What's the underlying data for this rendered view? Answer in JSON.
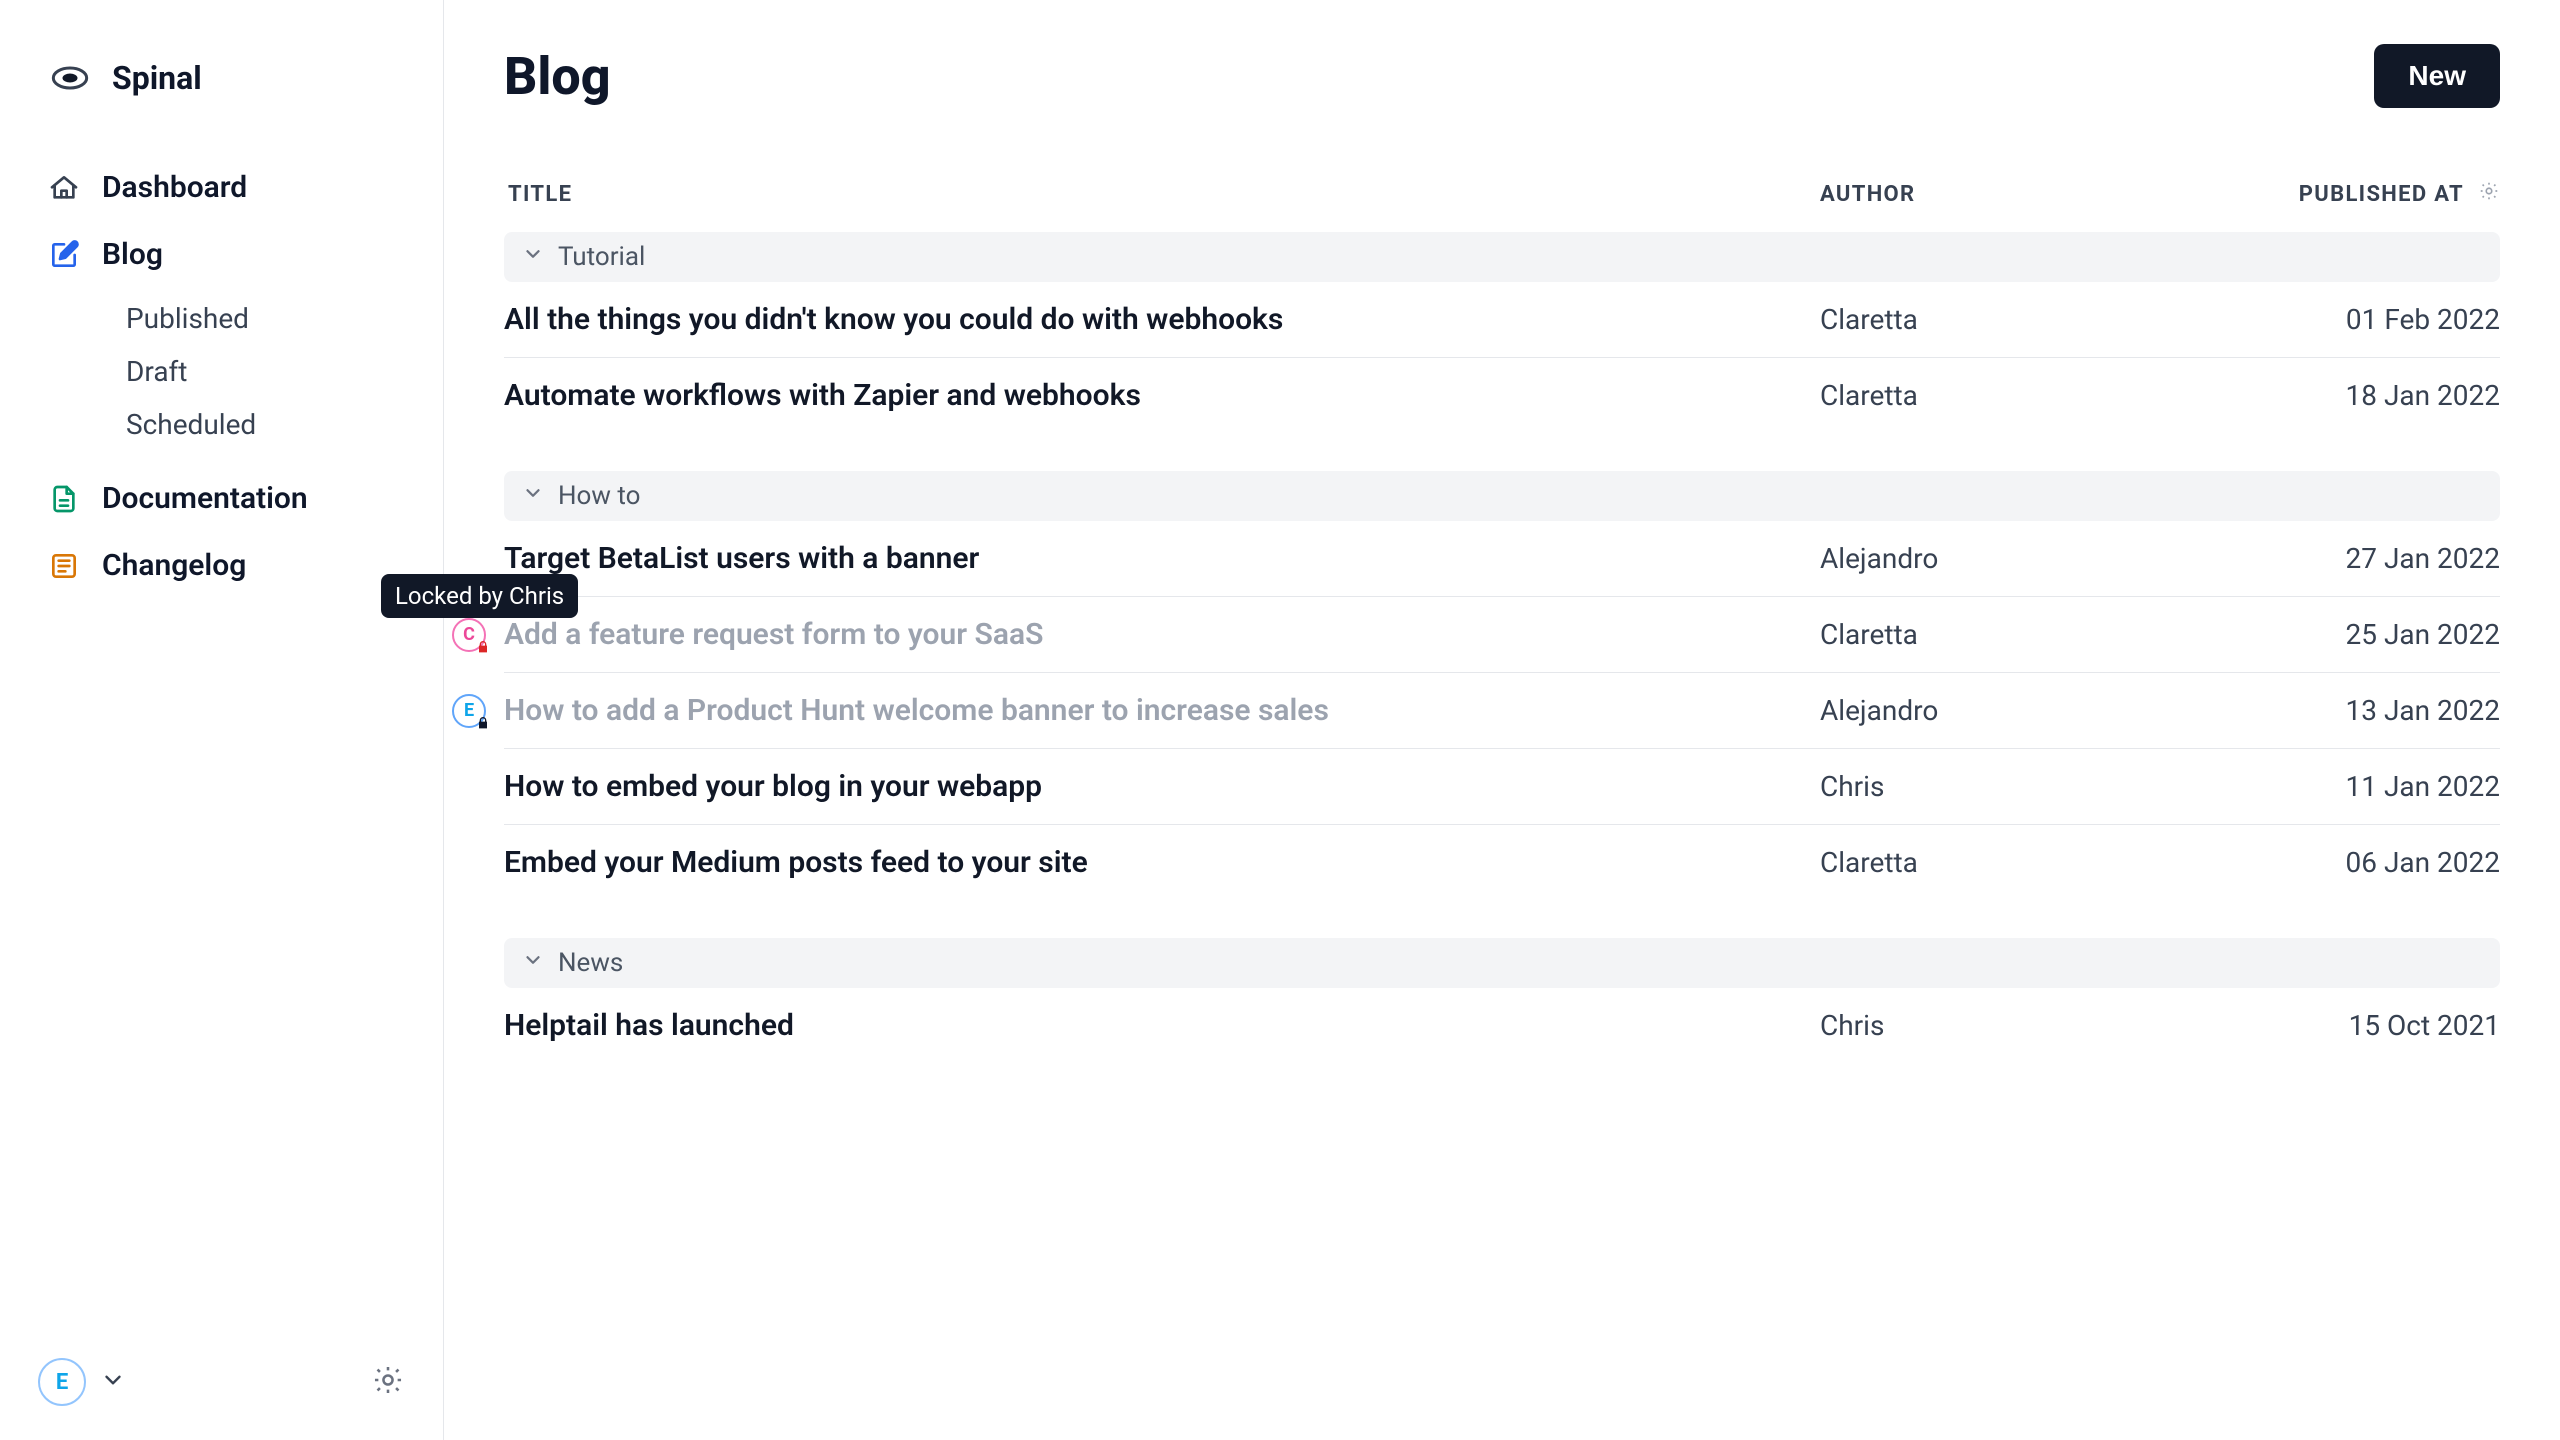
{
  "brand": {
    "name": "Spinal"
  },
  "sidebar": {
    "items": [
      {
        "label": "Dashboard"
      },
      {
        "label": "Blog"
      },
      {
        "label": "Documentation"
      },
      {
        "label": "Changelog"
      }
    ],
    "blog_sub": [
      {
        "label": "Published"
      },
      {
        "label": "Draft"
      },
      {
        "label": "Scheduled"
      }
    ],
    "user_initial": "E"
  },
  "page": {
    "title": "Blog",
    "new_button": "New"
  },
  "columns": {
    "title": "TITLE",
    "author": "AUTHOR",
    "published_at": "PUBLISHED AT"
  },
  "groups": [
    {
      "name": "Tutorial",
      "rows": [
        {
          "title": "All the things you didn't know you could do with webhooks",
          "author": "Claretta",
          "published": "01 Feb 2022"
        },
        {
          "title": "Automate workflows with Zapier and webhooks",
          "author": "Claretta",
          "published": "18 Jan 2022"
        }
      ]
    },
    {
      "name": "How to",
      "rows": [
        {
          "title": "Target BetaList users with a banner",
          "author": "Alejandro",
          "published": "27 Jan 2022"
        },
        {
          "title": "Add a feature request form to your SaaS",
          "author": "Claretta",
          "published": "25 Jan 2022",
          "locked_by_initial": "C",
          "locked_tooltip": "Locked by Chris",
          "lock_color": "pink",
          "lock_icon": "red"
        },
        {
          "title": "How to add a Product Hunt welcome banner to increase sales",
          "author": "Alejandro",
          "published": "13 Jan 2022",
          "locked_by_initial": "E",
          "lock_color": "sky",
          "lock_icon": "navy"
        },
        {
          "title": "How to embed your blog in your webapp",
          "author": "Chris",
          "published": "11 Jan 2022"
        },
        {
          "title": "Embed your Medium posts feed to your site",
          "author": "Claretta",
          "published": "06 Jan 2022"
        }
      ]
    },
    {
      "name": "News",
      "rows": [
        {
          "title": "Helptail has launched",
          "author": "Chris",
          "published": "15 Oct 2021"
        }
      ]
    }
  ]
}
